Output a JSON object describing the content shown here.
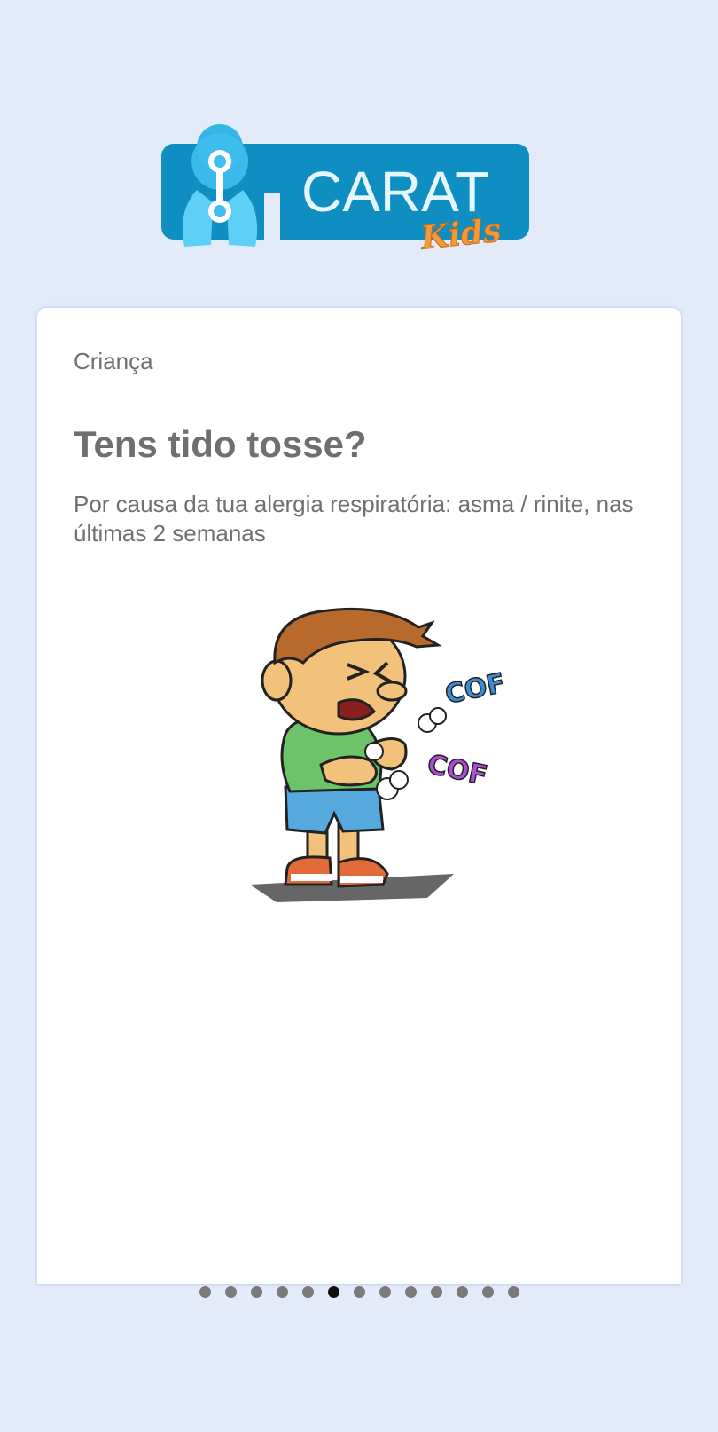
{
  "logo": {
    "main_text": "CARAT",
    "sub_text": "Kids",
    "brand_color": "#0f8ec2"
  },
  "card": {
    "category": "Criança",
    "question": "Tens tido tosse?",
    "subtitle": "Por causa da tua alergia respiratória: asma / rinite, nas últimas 2 semanas",
    "illustration": {
      "icon": "coughing-child-icon",
      "cough_word_1": "COF",
      "cough_word_2": "COF"
    }
  },
  "pager": {
    "total": 13,
    "active_index": 5
  }
}
